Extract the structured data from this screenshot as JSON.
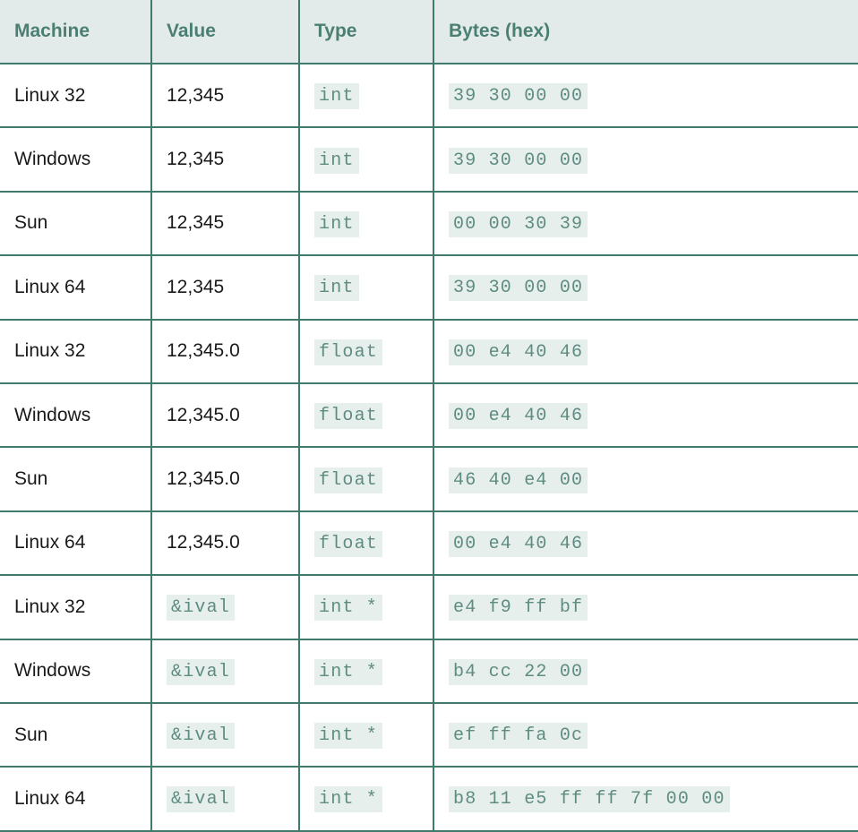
{
  "headers": [
    "Machine",
    "Value",
    "Type",
    "Bytes (hex)"
  ],
  "rows": [
    {
      "machine": "Linux 32",
      "value": "12,345",
      "value_code": false,
      "type": "int",
      "bytes": "39 30 00 00"
    },
    {
      "machine": "Windows",
      "value": "12,345",
      "value_code": false,
      "type": "int",
      "bytes": "39 30 00 00"
    },
    {
      "machine": "Sun",
      "value": "12,345",
      "value_code": false,
      "type": "int",
      "bytes": "00 00 30 39"
    },
    {
      "machine": "Linux 64",
      "value": "12,345",
      "value_code": false,
      "type": "int",
      "bytes": "39 30 00 00"
    },
    {
      "machine": "Linux 32",
      "value": "12,345.0",
      "value_code": false,
      "type": "float",
      "bytes": "00 e4 40 46"
    },
    {
      "machine": "Windows",
      "value": "12,345.0",
      "value_code": false,
      "type": "float",
      "bytes": "00 e4 40 46"
    },
    {
      "machine": "Sun",
      "value": "12,345.0",
      "value_code": false,
      "type": "float",
      "bytes": "46 40 e4 00"
    },
    {
      "machine": "Linux 64",
      "value": "12,345.0",
      "value_code": false,
      "type": "float",
      "bytes": "00 e4 40 46"
    },
    {
      "machine": "Linux 32",
      "value": "&ival",
      "value_code": true,
      "type": "int *",
      "bytes": "e4 f9 ff bf"
    },
    {
      "machine": "Windows",
      "value": "&ival",
      "value_code": true,
      "type": "int *",
      "bytes": "b4 cc 22 00"
    },
    {
      "machine": "Sun",
      "value": "&ival",
      "value_code": true,
      "type": "int *",
      "bytes": "ef ff fa 0c"
    },
    {
      "machine": "Linux 64",
      "value": "&ival",
      "value_code": true,
      "type": "int *",
      "bytes": "b8 11 e5 ff ff 7f 00 00"
    }
  ]
}
